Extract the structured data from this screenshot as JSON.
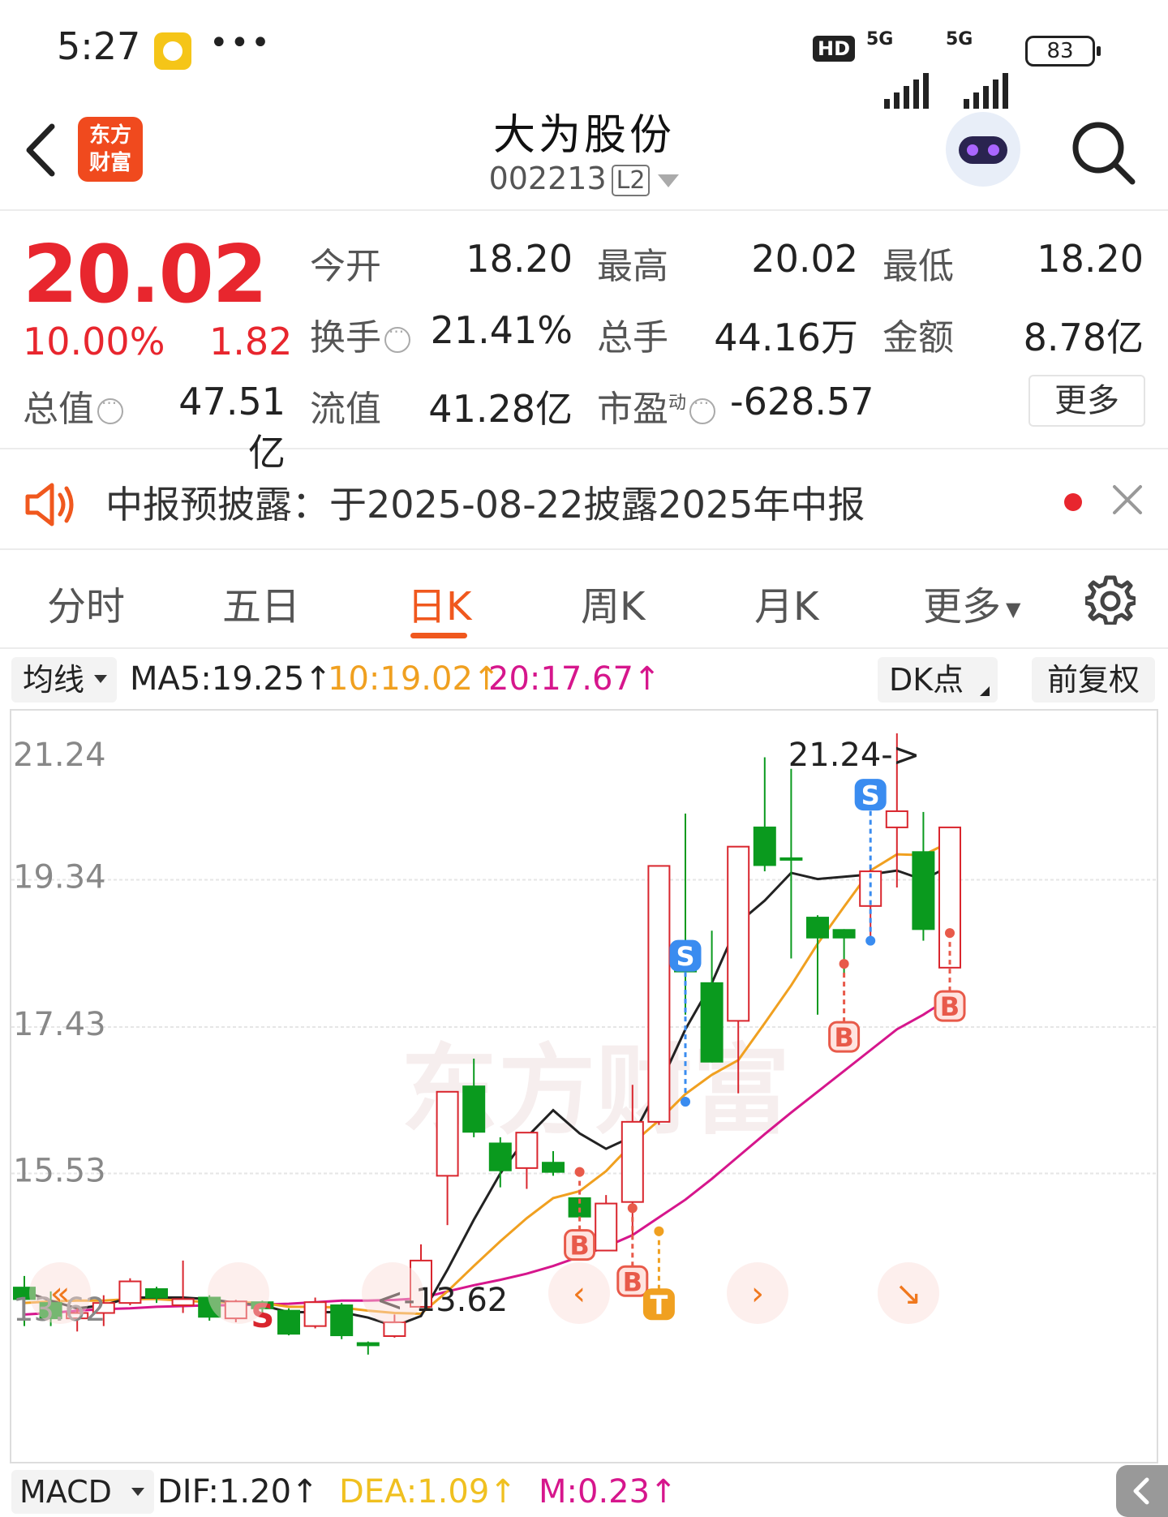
{
  "status_bar": {
    "time": "5:27",
    "dots": "•••",
    "hd": "HD",
    "net1": "5G",
    "net2": "5G",
    "battery": "83"
  },
  "header": {
    "title": "大为股份",
    "code": "002213",
    "level": "L2",
    "logo_line1": "东方",
    "logo_line2": "财富"
  },
  "quote": {
    "price": "20.02",
    "pct": "10.00%",
    "change": "1.82",
    "open_label": "今开",
    "open": "18.20",
    "high_label": "最高",
    "high": "20.02",
    "low_label": "最低",
    "low": "18.20",
    "turnover_label": "换手",
    "turnover": "21.41%",
    "volume_label": "总手",
    "volume": "44.16万",
    "amount_label": "金额",
    "amount": "8.78亿",
    "mktcap_label": "总值",
    "mktcap": "47.51亿",
    "float_label": "流值",
    "float": "41.28亿",
    "pe_label": "市盈",
    "pe_sup": "动",
    "pe": "-628.57",
    "more": "更多"
  },
  "notice": {
    "text": "中报预披露：于2025-08-22披露2025年中报"
  },
  "tabs": [
    "分时",
    "五日",
    "日K",
    "周K",
    "月K",
    "更多"
  ],
  "active_tab": "日K",
  "ma_bar": {
    "button": "均线",
    "ma5": "MA5:19.25↑",
    "ma10": "10:19.02↑",
    "ma20": "20:17.67↑",
    "dk": "DK点",
    "adjust": "前复权",
    "colors": {
      "ma5": "#222222",
      "ma10": "#f0a020",
      "ma20": "#d6168c"
    }
  },
  "chart_data": {
    "type": "candlestick",
    "y_ticks": [
      "21.24",
      "19.34",
      "17.43",
      "15.53",
      "13.62"
    ],
    "ylim": [
      13.62,
      21.24
    ],
    "high_annotation": "21.24->",
    "low_annotation": "<-13.62",
    "watermark": "东方财富",
    "candles": [
      [
        14.05,
        13.9,
        14.2,
        13.55
      ],
      [
        13.85,
        13.65,
        14.0,
        13.55
      ],
      [
        13.65,
        13.72,
        13.78,
        13.48
      ],
      [
        13.72,
        13.85,
        13.95,
        13.55
      ],
      [
        13.85,
        14.13,
        14.17,
        13.82
      ],
      [
        14.03,
        13.92,
        14.06,
        13.85
      ],
      [
        13.82,
        13.9,
        14.4,
        13.72
      ],
      [
        13.92,
        13.67,
        13.95,
        13.62
      ],
      [
        13.65,
        13.87,
        13.89,
        13.6
      ],
      [
        13.86,
        13.78,
        13.88,
        13.7
      ],
      [
        13.75,
        13.45,
        13.78,
        13.43
      ],
      [
        13.55,
        13.86,
        13.92,
        13.52
      ],
      [
        13.82,
        13.43,
        13.85,
        13.38
      ],
      [
        13.33,
        13.3,
        13.35,
        13.18
      ],
      [
        13.42,
        13.6,
        13.7,
        13.4
      ],
      [
        13.8,
        14.4,
        14.61,
        13.79
      ],
      [
        15.5,
        16.59,
        16.59,
        14.86
      ],
      [
        16.66,
        16.07,
        17.02,
        16.0
      ],
      [
        15.92,
        15.57,
        16.0,
        15.35
      ],
      [
        15.6,
        16.06,
        16.06,
        15.33
      ],
      [
        15.67,
        15.55,
        15.82,
        15.5
      ],
      [
        15.21,
        14.97,
        15.21,
        14.95
      ],
      [
        14.53,
        15.14,
        15.25,
        14.52
      ],
      [
        15.16,
        16.2,
        16.68,
        14.67
      ],
      [
        16.2,
        19.52,
        19.52,
        16.16
      ],
      [
        18.2,
        18.15,
        20.2,
        17.59
      ],
      [
        18.0,
        16.98,
        18.68,
        16.97
      ],
      [
        17.51,
        19.77,
        19.77,
        16.57
      ],
      [
        20.02,
        19.53,
        20.93,
        19.45
      ],
      [
        19.62,
        19.6,
        20.78,
        18.32
      ],
      [
        18.85,
        18.59,
        18.88,
        17.59
      ],
      [
        18.69,
        18.59,
        18.7,
        18.1
      ],
      [
        19.0,
        19.45,
        19.52,
        18.6
      ],
      [
        20.02,
        20.23,
        21.24,
        19.24
      ],
      [
        19.7,
        18.7,
        20.22,
        18.55
      ],
      [
        18.2,
        20.02,
        20.02,
        18.2
      ]
    ],
    "ma5": [
      14.0,
      13.88,
      13.78,
      13.82,
      13.92,
      13.92,
      13.92,
      13.9,
      13.85,
      13.82,
      13.73,
      13.73,
      13.73,
      13.66,
      13.55,
      13.68,
      14.28,
      14.93,
      15.53,
      16.0,
      16.35,
      16.05,
      15.85,
      16.01,
      16.66,
      17.4,
      18.0,
      18.78,
      19.07,
      19.43,
      19.35,
      19.38,
      19.41,
      19.46,
      19.34,
      19.52
    ],
    "ma10": [
      13.85,
      13.87,
      13.88,
      13.88,
      13.9,
      13.9,
      13.88,
      13.86,
      13.86,
      13.85,
      13.8,
      13.8,
      13.79,
      13.75,
      13.72,
      13.71,
      14.0,
      14.33,
      14.65,
      14.95,
      15.21,
      15.3,
      15.56,
      15.92,
      16.22,
      16.56,
      16.81,
      17.0,
      17.48,
      17.97,
      18.51,
      18.99,
      19.46,
      19.67,
      19.66,
      19.83
    ],
    "ma20": [
      13.7,
      13.72,
      13.75,
      13.77,
      13.78,
      13.8,
      13.81,
      13.82,
      13.82,
      13.83,
      13.84,
      13.86,
      13.88,
      13.88,
      13.89,
      13.91,
      14.0,
      14.08,
      14.15,
      14.23,
      14.33,
      14.45,
      14.58,
      14.73,
      14.96,
      15.19,
      15.46,
      15.75,
      16.04,
      16.32,
      16.59,
      16.86,
      17.13,
      17.4,
      17.59,
      17.81
    ],
    "signals": [
      {
        "index": 9,
        "label": "S",
        "kind": "sell-text"
      },
      {
        "index": 21,
        "label": "B",
        "kind": "buy",
        "price": 15.55,
        "above": false
      },
      {
        "index": 23,
        "label": "B",
        "kind": "buy",
        "price": 15.08,
        "above": false
      },
      {
        "index": 24,
        "label": "T",
        "kind": "t",
        "price": 14.78,
        "above": false
      },
      {
        "index": 25,
        "label": "S",
        "kind": "sell",
        "price": 16.46,
        "above": true
      },
      {
        "index": 31,
        "label": "B",
        "kind": "buy",
        "price": 18.25,
        "above": false
      },
      {
        "index": 32,
        "label": "S",
        "kind": "sell",
        "price": 18.55,
        "above": true
      },
      {
        "index": 35,
        "label": "B",
        "kind": "buy",
        "price": 18.65,
        "above": false
      }
    ]
  },
  "macd_bar": {
    "button": "MACD",
    "dif": "DIF:1.20↑",
    "dea": "DEA:1.09↑",
    "m": "M:0.23↑",
    "colors": {
      "dea": "#f0c020",
      "m": "#d6168c"
    }
  }
}
